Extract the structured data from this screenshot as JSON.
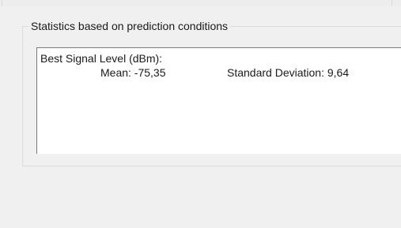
{
  "group": {
    "title": "Statistics based on prediction conditions"
  },
  "stats": {
    "heading": "Best Signal Level (dBm):",
    "mean": "Mean: -75,35",
    "std_dev": "Standard Deviation: 9,64"
  }
}
